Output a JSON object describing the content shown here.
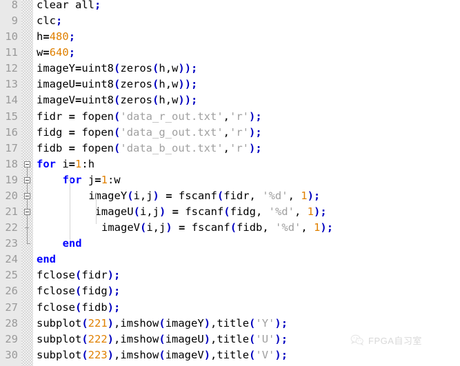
{
  "editor": {
    "app": "matlab-code-editor",
    "first_line_number": 8,
    "last_line_number": 30,
    "colors": {
      "background": "#ffffff",
      "gutter_background": "#e9e9e9",
      "line_number": "#9a9a9a",
      "keyword": "#0000ff",
      "number": "#e08000",
      "string": "#a0a0a0",
      "paren": "#0000c0",
      "plain": "#000000"
    }
  },
  "lines": [
    {
      "no": "8",
      "indent": 0,
      "text": "clear all;",
      "tokens": [
        {
          "t": "clear all",
          "c": "plain"
        },
        {
          "t": ";",
          "c": "semi"
        }
      ]
    },
    {
      "no": "9",
      "indent": 0,
      "text": "clc;",
      "tokens": [
        {
          "t": "clc",
          "c": "plain"
        },
        {
          "t": ";",
          "c": "semi"
        }
      ]
    },
    {
      "no": "10",
      "indent": 0,
      "text": "h=480;",
      "tokens": [
        {
          "t": "h",
          "c": "plain"
        },
        {
          "t": "=",
          "c": "op"
        },
        {
          "t": "480",
          "c": "num"
        },
        {
          "t": ";",
          "c": "semi"
        }
      ]
    },
    {
      "no": "11",
      "indent": 0,
      "text": "w=640;",
      "tokens": [
        {
          "t": "w",
          "c": "plain"
        },
        {
          "t": "=",
          "c": "op"
        },
        {
          "t": "640",
          "c": "num"
        },
        {
          "t": ";",
          "c": "semi"
        }
      ]
    },
    {
      "no": "12",
      "indent": 0,
      "text": "imageY=uint8(zeros(h,w));",
      "tokens": [
        {
          "t": "imageY",
          "c": "plain"
        },
        {
          "t": "=",
          "c": "op"
        },
        {
          "t": "uint8",
          "c": "plain"
        },
        {
          "t": "(",
          "c": "paren"
        },
        {
          "t": "zeros",
          "c": "plain"
        },
        {
          "t": "(",
          "c": "paren"
        },
        {
          "t": "h,w",
          "c": "plain"
        },
        {
          "t": "))",
          "c": "paren"
        },
        {
          "t": ";",
          "c": "semi"
        }
      ]
    },
    {
      "no": "13",
      "indent": 0,
      "text": "imageU=uint8(zeros(h,w));",
      "tokens": [
        {
          "t": "imageU",
          "c": "plain"
        },
        {
          "t": "=",
          "c": "op"
        },
        {
          "t": "uint8",
          "c": "plain"
        },
        {
          "t": "(",
          "c": "paren"
        },
        {
          "t": "zeros",
          "c": "plain"
        },
        {
          "t": "(",
          "c": "paren"
        },
        {
          "t": "h,w",
          "c": "plain"
        },
        {
          "t": "))",
          "c": "paren"
        },
        {
          "t": ";",
          "c": "semi"
        }
      ]
    },
    {
      "no": "14",
      "indent": 0,
      "text": "imageV=uint8(zeros(h,w));",
      "tokens": [
        {
          "t": "imageV",
          "c": "plain"
        },
        {
          "t": "=",
          "c": "op"
        },
        {
          "t": "uint8",
          "c": "plain"
        },
        {
          "t": "(",
          "c": "paren"
        },
        {
          "t": "zeros",
          "c": "plain"
        },
        {
          "t": "(",
          "c": "paren"
        },
        {
          "t": "h,w",
          "c": "plain"
        },
        {
          "t": "))",
          "c": "paren"
        },
        {
          "t": ";",
          "c": "semi"
        }
      ]
    },
    {
      "no": "15",
      "indent": 0,
      "text": "fidr = fopen('data_r_out.txt','r');",
      "tokens": [
        {
          "t": "fidr ",
          "c": "plain"
        },
        {
          "t": "=",
          "c": "op"
        },
        {
          "t": " fopen",
          "c": "plain"
        },
        {
          "t": "(",
          "c": "paren"
        },
        {
          "t": "'data_r_out.txt'",
          "c": "str"
        },
        {
          "t": ",",
          "c": "plain"
        },
        {
          "t": "'r'",
          "c": "str"
        },
        {
          "t": ")",
          "c": "paren"
        },
        {
          "t": ";",
          "c": "semi"
        }
      ]
    },
    {
      "no": "16",
      "indent": 0,
      "text": "fidg = fopen('data_g_out.txt','r');",
      "tokens": [
        {
          "t": "fidg ",
          "c": "plain"
        },
        {
          "t": "=",
          "c": "op"
        },
        {
          "t": " fopen",
          "c": "plain"
        },
        {
          "t": "(",
          "c": "paren"
        },
        {
          "t": "'data_g_out.txt'",
          "c": "str"
        },
        {
          "t": ",",
          "c": "plain"
        },
        {
          "t": "'r'",
          "c": "str"
        },
        {
          "t": ")",
          "c": "paren"
        },
        {
          "t": ";",
          "c": "semi"
        }
      ]
    },
    {
      "no": "17",
      "indent": 0,
      "text": "fidb = fopen('data_b_out.txt','r');",
      "tokens": [
        {
          "t": "fidb ",
          "c": "plain"
        },
        {
          "t": "=",
          "c": "op"
        },
        {
          "t": " fopen",
          "c": "plain"
        },
        {
          "t": "(",
          "c": "paren"
        },
        {
          "t": "'data_b_out.txt'",
          "c": "str"
        },
        {
          "t": ",",
          "c": "plain"
        },
        {
          "t": "'r'",
          "c": "str"
        },
        {
          "t": ")",
          "c": "paren"
        },
        {
          "t": ";",
          "c": "semi"
        }
      ]
    },
    {
      "no": "18",
      "indent": 0,
      "text": "for i=1:h",
      "tokens": [
        {
          "t": "for",
          "c": "kw"
        },
        {
          "t": " i",
          "c": "plain"
        },
        {
          "t": "=",
          "c": "op"
        },
        {
          "t": "1",
          "c": "num"
        },
        {
          "t": ":h",
          "c": "plain"
        }
      ]
    },
    {
      "no": "19",
      "indent": 4,
      "text": "for j=1:w",
      "tokens": [
        {
          "t": "for",
          "c": "kw"
        },
        {
          "t": " j",
          "c": "plain"
        },
        {
          "t": "=",
          "c": "op"
        },
        {
          "t": "1",
          "c": "num"
        },
        {
          "t": ":w",
          "c": "plain"
        }
      ]
    },
    {
      "no": "20",
      "indent": 8,
      "text": "imageY(i,j) = fscanf(fidr, '%d', 1);",
      "tokens": [
        {
          "t": "imageY",
          "c": "plain"
        },
        {
          "t": "(",
          "c": "paren"
        },
        {
          "t": "i,j",
          "c": "plain"
        },
        {
          "t": ")",
          "c": "paren"
        },
        {
          "t": " ",
          "c": "plain"
        },
        {
          "t": "=",
          "c": "op"
        },
        {
          "t": " fscanf",
          "c": "plain"
        },
        {
          "t": "(",
          "c": "paren"
        },
        {
          "t": "fidr, ",
          "c": "plain"
        },
        {
          "t": "'%d'",
          "c": "str"
        },
        {
          "t": ", ",
          "c": "plain"
        },
        {
          "t": "1",
          "c": "num"
        },
        {
          "t": ")",
          "c": "paren"
        },
        {
          "t": ";",
          "c": "semi"
        }
      ]
    },
    {
      "no": "21",
      "indent": 9,
      "text": "imageU(i,j) = fscanf(fidg, '%d', 1);",
      "tokens": [
        {
          "t": "imageU",
          "c": "plain"
        },
        {
          "t": "(",
          "c": "paren"
        },
        {
          "t": "i,j",
          "c": "plain"
        },
        {
          "t": ")",
          "c": "paren"
        },
        {
          "t": " ",
          "c": "plain"
        },
        {
          "t": "=",
          "c": "op"
        },
        {
          "t": " fscanf",
          "c": "plain"
        },
        {
          "t": "(",
          "c": "paren"
        },
        {
          "t": "fidg, ",
          "c": "plain"
        },
        {
          "t": "'%d'",
          "c": "str"
        },
        {
          "t": ", ",
          "c": "plain"
        },
        {
          "t": "1",
          "c": "num"
        },
        {
          "t": ")",
          "c": "paren"
        },
        {
          "t": ";",
          "c": "semi"
        }
      ]
    },
    {
      "no": "22",
      "indent": 10,
      "text": "imageV(i,j) = fscanf(fidb, '%d', 1);",
      "tokens": [
        {
          "t": "imageV",
          "c": "plain"
        },
        {
          "t": "(",
          "c": "paren"
        },
        {
          "t": "i,j",
          "c": "plain"
        },
        {
          "t": ")",
          "c": "paren"
        },
        {
          "t": " ",
          "c": "plain"
        },
        {
          "t": "=",
          "c": "op"
        },
        {
          "t": " fscanf",
          "c": "plain"
        },
        {
          "t": "(",
          "c": "paren"
        },
        {
          "t": "fidb, ",
          "c": "plain"
        },
        {
          "t": "'%d'",
          "c": "str"
        },
        {
          "t": ", ",
          "c": "plain"
        },
        {
          "t": "1",
          "c": "num"
        },
        {
          "t": ")",
          "c": "paren"
        },
        {
          "t": ";",
          "c": "semi"
        }
      ]
    },
    {
      "no": "23",
      "indent": 4,
      "text": "end",
      "tokens": [
        {
          "t": "end",
          "c": "kw"
        }
      ]
    },
    {
      "no": "24",
      "indent": 0,
      "text": "end",
      "tokens": [
        {
          "t": "end",
          "c": "kw"
        }
      ]
    },
    {
      "no": "25",
      "indent": 0,
      "text": "fclose(fidr);",
      "tokens": [
        {
          "t": "fclose",
          "c": "plain"
        },
        {
          "t": "(",
          "c": "paren"
        },
        {
          "t": "fidr",
          "c": "plain"
        },
        {
          "t": ")",
          "c": "paren"
        },
        {
          "t": ";",
          "c": "semi"
        }
      ]
    },
    {
      "no": "26",
      "indent": 0,
      "text": "fclose(fidg);",
      "tokens": [
        {
          "t": "fclose",
          "c": "plain"
        },
        {
          "t": "(",
          "c": "paren"
        },
        {
          "t": "fidg",
          "c": "plain"
        },
        {
          "t": ")",
          "c": "paren"
        },
        {
          "t": ";",
          "c": "semi"
        }
      ]
    },
    {
      "no": "27",
      "indent": 0,
      "text": "fclose(fidb);",
      "tokens": [
        {
          "t": "fclose",
          "c": "plain"
        },
        {
          "t": "(",
          "c": "paren"
        },
        {
          "t": "fidb",
          "c": "plain"
        },
        {
          "t": ")",
          "c": "paren"
        },
        {
          "t": ";",
          "c": "semi"
        }
      ]
    },
    {
      "no": "28",
      "indent": 0,
      "text": "subplot(221),imshow(imageY),title('Y');",
      "tokens": [
        {
          "t": "subplot",
          "c": "plain"
        },
        {
          "t": "(",
          "c": "paren"
        },
        {
          "t": "221",
          "c": "num"
        },
        {
          "t": ")",
          "c": "paren"
        },
        {
          "t": ",imshow",
          "c": "plain"
        },
        {
          "t": "(",
          "c": "paren"
        },
        {
          "t": "imageY",
          "c": "plain"
        },
        {
          "t": ")",
          "c": "paren"
        },
        {
          "t": ",title",
          "c": "plain"
        },
        {
          "t": "(",
          "c": "paren"
        },
        {
          "t": "'Y'",
          "c": "str"
        },
        {
          "t": ")",
          "c": "paren"
        },
        {
          "t": ";",
          "c": "semi"
        }
      ]
    },
    {
      "no": "29",
      "indent": 0,
      "text": "subplot(222),imshow(imageU),title('U');",
      "tokens": [
        {
          "t": "subplot",
          "c": "plain"
        },
        {
          "t": "(",
          "c": "paren"
        },
        {
          "t": "222",
          "c": "num"
        },
        {
          "t": ")",
          "c": "paren"
        },
        {
          "t": ",imshow",
          "c": "plain"
        },
        {
          "t": "(",
          "c": "paren"
        },
        {
          "t": "imageU",
          "c": "plain"
        },
        {
          "t": ")",
          "c": "paren"
        },
        {
          "t": ",title",
          "c": "plain"
        },
        {
          "t": "(",
          "c": "paren"
        },
        {
          "t": "'U'",
          "c": "str"
        },
        {
          "t": ")",
          "c": "paren"
        },
        {
          "t": ";",
          "c": "semi"
        }
      ]
    },
    {
      "no": "30",
      "indent": 0,
      "text": "subplot(223),imshow(imageV),title('V');",
      "tokens": [
        {
          "t": "subplot",
          "c": "plain"
        },
        {
          "t": "(",
          "c": "paren"
        },
        {
          "t": "223",
          "c": "num"
        },
        {
          "t": ")",
          "c": "paren"
        },
        {
          "t": ",imshow",
          "c": "plain"
        },
        {
          "t": "(",
          "c": "paren"
        },
        {
          "t": "imageV",
          "c": "plain"
        },
        {
          "t": ")",
          "c": "paren"
        },
        {
          "t": ",title",
          "c": "plain"
        },
        {
          "t": "(",
          "c": "paren"
        },
        {
          "t": "'V'",
          "c": "str"
        },
        {
          "t": ")",
          "c": "paren"
        },
        {
          "t": ";",
          "c": "semi"
        }
      ]
    }
  ],
  "fold_markers": [
    {
      "line_no": "18",
      "type": "collapse-box"
    },
    {
      "line_no": "19",
      "type": "collapse-box"
    },
    {
      "line_no": "20",
      "type": "collapse-box"
    },
    {
      "line_no": "21",
      "type": "collapse-box"
    },
    {
      "line_no": "22",
      "type": "tick"
    },
    {
      "line_no": "23",
      "type": "end-bracket"
    }
  ],
  "watermark": {
    "text": "FPGA自习室",
    "logo": "wechat-icon"
  }
}
